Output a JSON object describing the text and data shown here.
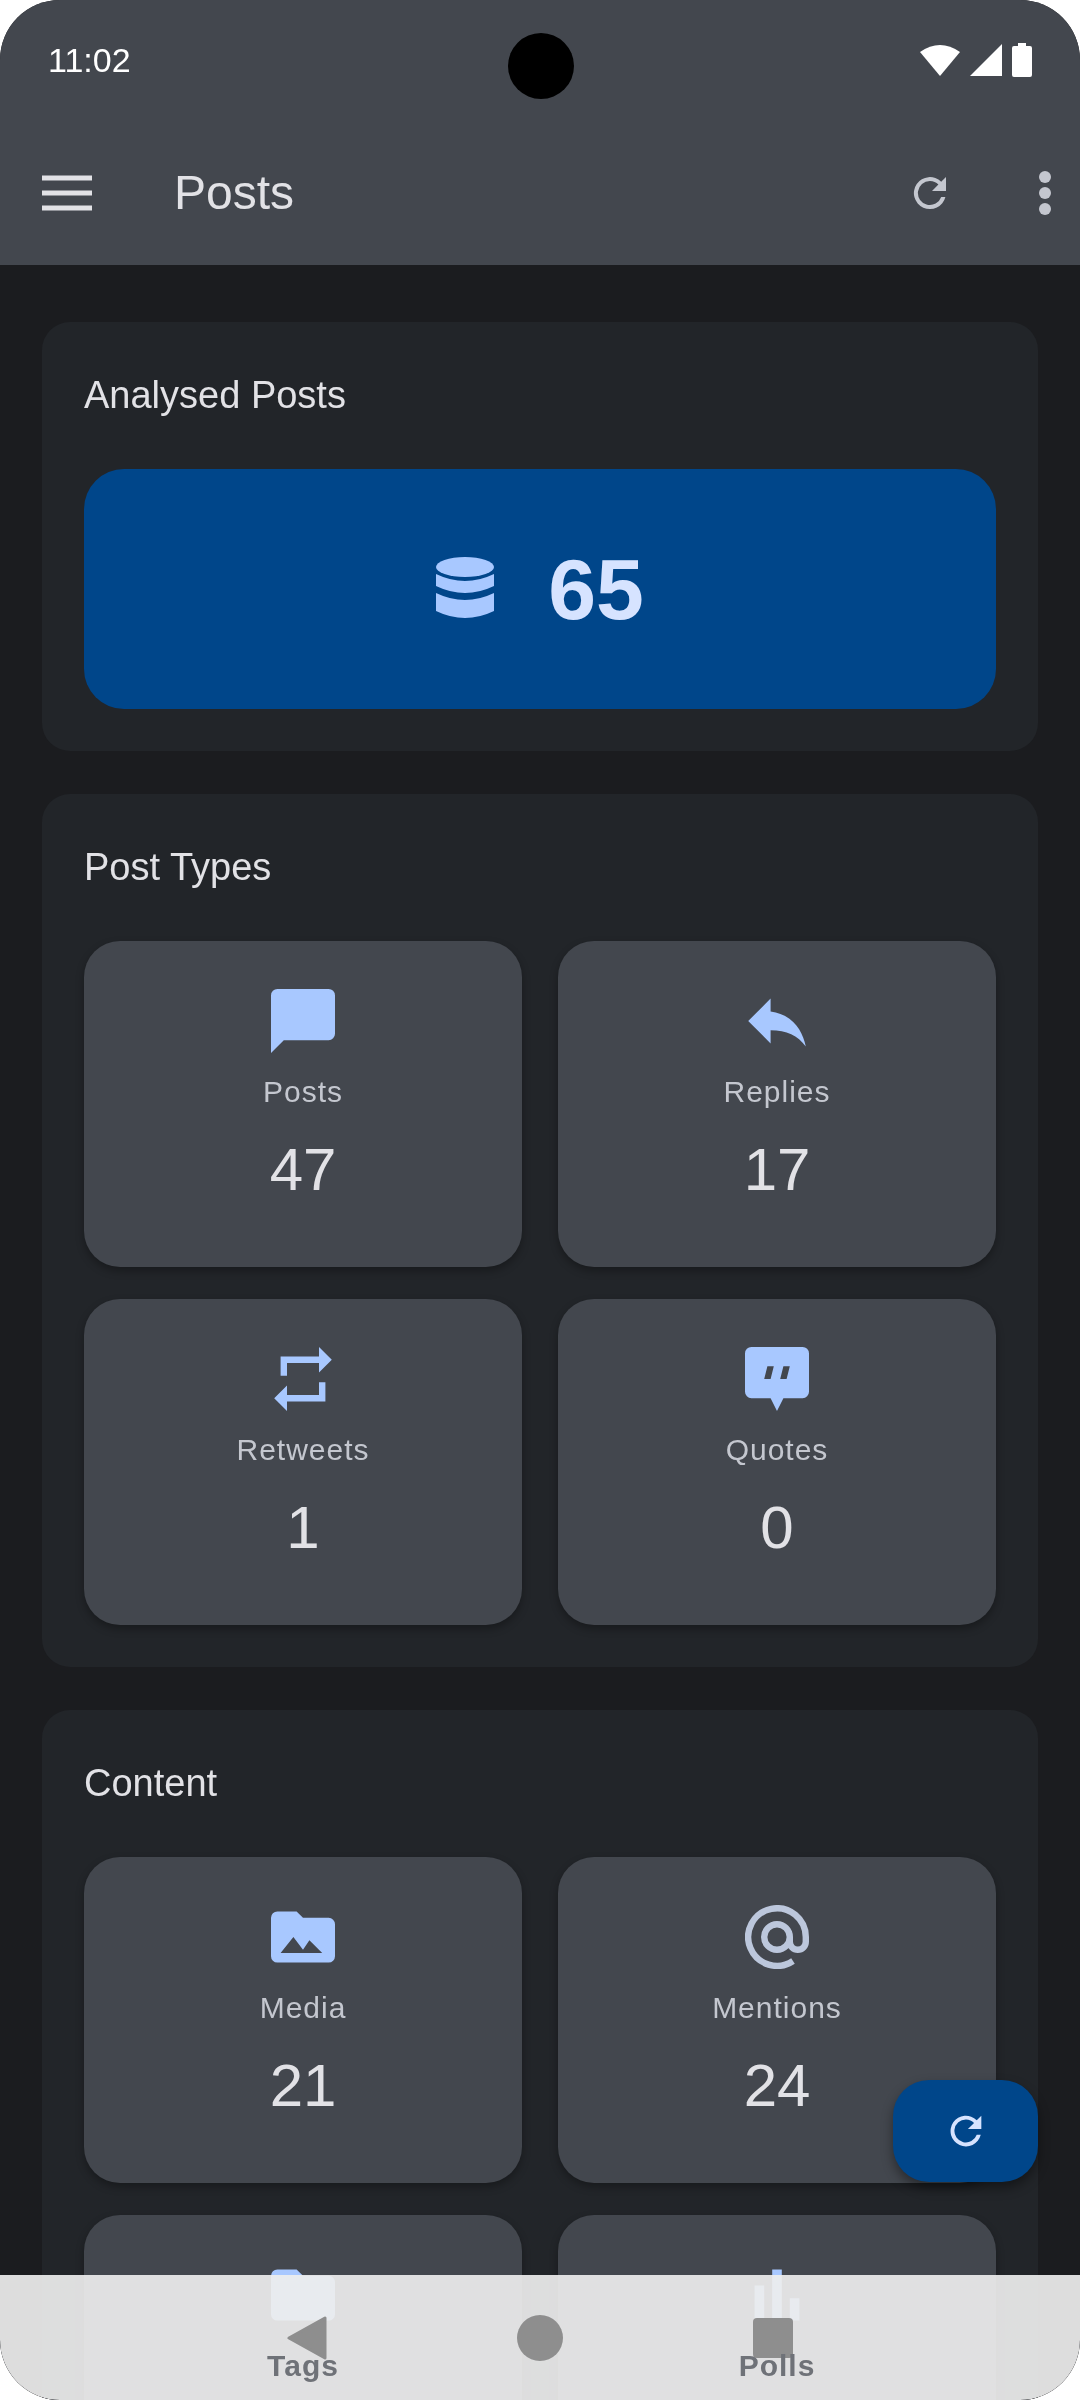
{
  "status_bar": {
    "time": "11:02"
  },
  "app_bar": {
    "title": "Posts"
  },
  "total": {
    "title": "Analysed Posts",
    "value": "65"
  },
  "sections": [
    {
      "title": "Post Types",
      "items": [
        {
          "kind": "posts",
          "label": "Posts",
          "value": "47"
        },
        {
          "kind": "replies",
          "label": "Replies",
          "value": "17"
        },
        {
          "kind": "retweets",
          "label": "Retweets",
          "value": "1"
        },
        {
          "kind": "quotes",
          "label": "Quotes",
          "value": "0"
        }
      ]
    },
    {
      "title": "Content",
      "items": [
        {
          "kind": "media",
          "label": "Media",
          "value": "21"
        },
        {
          "kind": "mentions",
          "label": "Mentions",
          "value": "24"
        },
        {
          "kind": "tags",
          "label": "Tags"
        },
        {
          "kind": "polls",
          "label": "Polls"
        }
      ]
    }
  ]
}
